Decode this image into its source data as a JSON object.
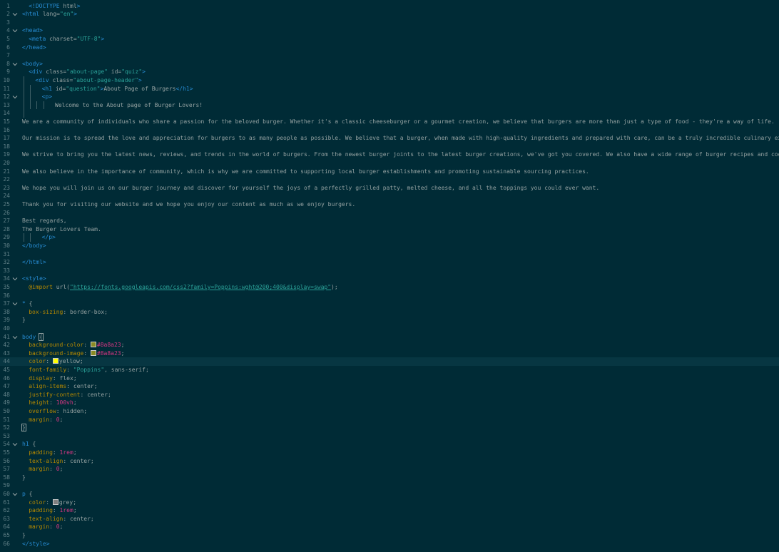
{
  "editor": {
    "active_line": 44,
    "colors": {
      "background": "#002b36",
      "active_line": "#073642",
      "tag": "#268bd2",
      "string": "#2aa198",
      "property": "#b58900",
      "number": "#d33682"
    },
    "lines": [
      {
        "n": "1",
        "indent": 1,
        "fold": false,
        "segments": [
          {
            "t": "doc",
            "s": "<!DOCTYPE"
          },
          {
            "t": "attr",
            "s": " html"
          },
          {
            "t": "doc",
            "s": ">"
          }
        ]
      },
      {
        "n": "2",
        "indent": 0,
        "fold": true,
        "segments": [
          {
            "t": "tag",
            "s": "<html"
          },
          {
            "t": "attr",
            "s": " lang="
          },
          {
            "t": "val",
            "s": "\"en\""
          },
          {
            "t": "tag",
            "s": ">"
          }
        ]
      },
      {
        "n": "3",
        "indent": 0,
        "fold": false,
        "segments": []
      },
      {
        "n": "4",
        "indent": 0,
        "fold": true,
        "segments": [
          {
            "t": "tag",
            "s": "<head>"
          }
        ]
      },
      {
        "n": "5",
        "indent": 1,
        "fold": false,
        "segments": [
          {
            "t": "tag",
            "s": "<meta"
          },
          {
            "t": "attr",
            "s": " charset="
          },
          {
            "t": "val",
            "s": "\"UTF-8\""
          },
          {
            "t": "tag",
            "s": ">"
          }
        ]
      },
      {
        "n": "6",
        "indent": 0,
        "fold": false,
        "segments": [
          {
            "t": "tag",
            "s": "</head>"
          }
        ]
      },
      {
        "n": "7",
        "indent": 0,
        "fold": false,
        "segments": []
      },
      {
        "n": "8",
        "indent": 0,
        "fold": true,
        "segments": [
          {
            "t": "tag",
            "s": "<body>"
          }
        ]
      },
      {
        "n": "9",
        "indent": 1,
        "fold": false,
        "segments": [
          {
            "t": "tag",
            "s": "<div"
          },
          {
            "t": "attr",
            "s": " class="
          },
          {
            "t": "val",
            "s": "\"about-page\""
          },
          {
            "t": "attr",
            "s": " id="
          },
          {
            "t": "val",
            "s": "\"quiz\""
          },
          {
            "t": "tag",
            "s": ">"
          }
        ]
      },
      {
        "n": "10",
        "indent": 2,
        "fold": false,
        "segments": [
          {
            "t": "tag",
            "s": "<div"
          },
          {
            "t": "attr",
            "s": " class="
          },
          {
            "t": "val",
            "s": "\"about-page-header\""
          },
          {
            "t": "tag",
            "s": ">"
          }
        ]
      },
      {
        "n": "11",
        "indent": 3,
        "fold": false,
        "segments": [
          {
            "t": "tag",
            "s": "<h1"
          },
          {
            "t": "attr",
            "s": " id="
          },
          {
            "t": "val",
            "s": "\"question\""
          },
          {
            "t": "tag",
            "s": ">"
          },
          {
            "t": "text",
            "s": "About Page of Burgers"
          },
          {
            "t": "tag",
            "s": "</h1>"
          }
        ]
      },
      {
        "n": "12",
        "indent": 3,
        "fold": true,
        "segments": [
          {
            "t": "tag",
            "s": "<p>"
          }
        ]
      },
      {
        "n": "13",
        "indent": 5,
        "fold": false,
        "segments": [
          {
            "t": "text",
            "s": "Welcome to the About page of Burger Lovers!"
          }
        ]
      },
      {
        "n": "14",
        "indent": 0,
        "fold": false,
        "guides": [
          1
        ],
        "segments": []
      },
      {
        "n": "15",
        "indent": 0,
        "fold": false,
        "segments": [
          {
            "t": "text",
            "s": "We are a community of individuals who share a passion for the beloved burger. Whether it's a classic cheeseburger or a gourmet creation, we believe that burgers are more than just a type of food - they're a way of life."
          }
        ]
      },
      {
        "n": "16",
        "indent": 0,
        "fold": false,
        "segments": []
      },
      {
        "n": "17",
        "indent": 0,
        "fold": false,
        "segments": [
          {
            "t": "text",
            "s": "Our mission is to spread the love and appreciation for burgers to as many people as possible. We believe that a burger, when made with high-quality ingredients and prepared with care, can be a truly incredible culinary experience."
          }
        ]
      },
      {
        "n": "18",
        "indent": 0,
        "fold": false,
        "segments": []
      },
      {
        "n": "19",
        "indent": 0,
        "fold": false,
        "segments": [
          {
            "t": "text",
            "s": "We strive to bring you the latest news, reviews, and trends in the world of burgers. From the newest burger joints to the latest burger creations, we've got you covered. We also have a wide range of burger recipes and cooking tips f"
          }
        ]
      },
      {
        "n": "20",
        "indent": 0,
        "fold": false,
        "segments": []
      },
      {
        "n": "21",
        "indent": 0,
        "fold": false,
        "segments": [
          {
            "t": "text",
            "s": "We also believe in the importance of community, which is why we are committed to supporting local burger establishments and promoting sustainable sourcing practices."
          }
        ]
      },
      {
        "n": "22",
        "indent": 0,
        "fold": false,
        "segments": []
      },
      {
        "n": "23",
        "indent": 0,
        "fold": false,
        "segments": [
          {
            "t": "text",
            "s": "We hope you will join us on our burger journey and discover for yourself the joys of a perfectly grilled patty, melted cheese, and all the toppings you could ever want."
          }
        ]
      },
      {
        "n": "24",
        "indent": 0,
        "fold": false,
        "segments": []
      },
      {
        "n": "25",
        "indent": 0,
        "fold": false,
        "segments": [
          {
            "t": "text",
            "s": "Thank you for visiting our website and we hope you enjoy our content as much as we enjoy burgers."
          }
        ]
      },
      {
        "n": "26",
        "indent": 0,
        "fold": false,
        "segments": []
      },
      {
        "n": "27",
        "indent": 0,
        "fold": false,
        "segments": [
          {
            "t": "text",
            "s": "Best regards,"
          }
        ]
      },
      {
        "n": "28",
        "indent": 0,
        "fold": false,
        "segments": [
          {
            "t": "text",
            "s": "The Burger Lovers Team."
          }
        ]
      },
      {
        "n": "29",
        "indent": 3,
        "fold": false,
        "guides": [
          1,
          2
        ],
        "segments": [
          {
            "t": "tag",
            "s": "</p>"
          }
        ]
      },
      {
        "n": "30",
        "indent": 0,
        "fold": false,
        "segments": [
          {
            "t": "tag",
            "s": "</body>"
          }
        ]
      },
      {
        "n": "31",
        "indent": 0,
        "fold": false,
        "segments": []
      },
      {
        "n": "32",
        "indent": 0,
        "fold": false,
        "segments": [
          {
            "t": "tag",
            "s": "</html>"
          }
        ]
      },
      {
        "n": "33",
        "indent": 0,
        "fold": false,
        "segments": []
      },
      {
        "n": "34",
        "indent": 0,
        "fold": true,
        "segments": [
          {
            "t": "tag",
            "s": "<style>"
          }
        ]
      },
      {
        "n": "35",
        "indent": 1,
        "fold": false,
        "segments": [
          {
            "t": "at",
            "s": "@import"
          },
          {
            "t": "fn",
            "s": " url("
          },
          {
            "t": "url",
            "s": "\"https://fonts.googleapis.com/css2?family=Poppins:wght@200;400&display=swap\""
          },
          {
            "t": "fn",
            "s": ");"
          }
        ]
      },
      {
        "n": "36",
        "indent": 0,
        "fold": false,
        "segments": []
      },
      {
        "n": "37",
        "indent": 0,
        "fold": true,
        "segments": [
          {
            "t": "sel",
            "s": "*"
          },
          {
            "t": "punc",
            "s": " {"
          }
        ]
      },
      {
        "n": "38",
        "indent": 1,
        "fold": false,
        "segments": [
          {
            "t": "prop",
            "s": "box-sizing"
          },
          {
            "t": "punc",
            "s": ": "
          },
          {
            "t": "text",
            "s": "border-box;"
          }
        ]
      },
      {
        "n": "39",
        "indent": 0,
        "fold": false,
        "segments": [
          {
            "t": "punc",
            "s": "}"
          }
        ]
      },
      {
        "n": "40",
        "indent": 0,
        "fold": false,
        "segments": []
      },
      {
        "n": "41",
        "indent": 0,
        "fold": true,
        "segments": [
          {
            "t": "sel",
            "s": "body"
          },
          {
            "t": "punc",
            "s": " "
          },
          {
            "t": "brace",
            "s": "{"
          }
        ]
      },
      {
        "n": "42",
        "indent": 1,
        "fold": false,
        "segments": [
          {
            "t": "prop",
            "s": "background-color"
          },
          {
            "t": "punc",
            "s": ": "
          },
          {
            "t": "swatch",
            "s": "#8a8a23"
          },
          {
            "t": "num",
            "s": "#8a8a23"
          },
          {
            "t": "punc",
            "s": ";"
          }
        ]
      },
      {
        "n": "43",
        "indent": 1,
        "fold": false,
        "segments": [
          {
            "t": "prop",
            "s": "background-image"
          },
          {
            "t": "punc",
            "s": ": "
          },
          {
            "t": "swatch",
            "s": "#8a8a23"
          },
          {
            "t": "num",
            "s": "#8a8a23"
          },
          {
            "t": "punc",
            "s": ";"
          }
        ]
      },
      {
        "n": "44",
        "indent": 1,
        "fold": false,
        "segments": [
          {
            "t": "prop",
            "s": "color"
          },
          {
            "t": "punc",
            "s": ": "
          },
          {
            "t": "swatch",
            "s": "#ffff00"
          },
          {
            "t": "text",
            "s": "yellow;"
          }
        ]
      },
      {
        "n": "45",
        "indent": 1,
        "fold": false,
        "segments": [
          {
            "t": "prop",
            "s": "font-family"
          },
          {
            "t": "punc",
            "s": ": "
          },
          {
            "t": "val",
            "s": "\"Poppins\""
          },
          {
            "t": "text",
            "s": ", sans-serif;"
          }
        ]
      },
      {
        "n": "46",
        "indent": 1,
        "fold": false,
        "segments": [
          {
            "t": "prop",
            "s": "display"
          },
          {
            "t": "punc",
            "s": ": "
          },
          {
            "t": "text",
            "s": "flex;"
          }
        ]
      },
      {
        "n": "47",
        "indent": 1,
        "fold": false,
        "segments": [
          {
            "t": "prop",
            "s": "align-items"
          },
          {
            "t": "punc",
            "s": ": "
          },
          {
            "t": "text",
            "s": "center;"
          }
        ]
      },
      {
        "n": "48",
        "indent": 1,
        "fold": false,
        "segments": [
          {
            "t": "prop",
            "s": "justify-content"
          },
          {
            "t": "punc",
            "s": ": "
          },
          {
            "t": "text",
            "s": "center;"
          }
        ]
      },
      {
        "n": "49",
        "indent": 1,
        "fold": false,
        "segments": [
          {
            "t": "prop",
            "s": "height"
          },
          {
            "t": "punc",
            "s": ": "
          },
          {
            "t": "num",
            "s": "100vh"
          },
          {
            "t": "punc",
            "s": ";"
          }
        ]
      },
      {
        "n": "50",
        "indent": 1,
        "fold": false,
        "segments": [
          {
            "t": "prop",
            "s": "overflow"
          },
          {
            "t": "punc",
            "s": ": "
          },
          {
            "t": "text",
            "s": "hidden;"
          }
        ]
      },
      {
        "n": "51",
        "indent": 1,
        "fold": false,
        "segments": [
          {
            "t": "prop",
            "s": "margin"
          },
          {
            "t": "punc",
            "s": ": "
          },
          {
            "t": "num",
            "s": "0"
          },
          {
            "t": "punc",
            "s": ";"
          }
        ]
      },
      {
        "n": "52",
        "indent": 0,
        "fold": false,
        "segments": [
          {
            "t": "brace",
            "s": "}"
          }
        ]
      },
      {
        "n": "53",
        "indent": 0,
        "fold": false,
        "segments": []
      },
      {
        "n": "54",
        "indent": 0,
        "fold": true,
        "segments": [
          {
            "t": "sel",
            "s": "h1"
          },
          {
            "t": "punc",
            "s": " {"
          }
        ]
      },
      {
        "n": "55",
        "indent": 1,
        "fold": false,
        "segments": [
          {
            "t": "prop",
            "s": "padding"
          },
          {
            "t": "punc",
            "s": ": "
          },
          {
            "t": "num",
            "s": "1rem"
          },
          {
            "t": "punc",
            "s": ";"
          }
        ]
      },
      {
        "n": "56",
        "indent": 1,
        "fold": false,
        "segments": [
          {
            "t": "prop",
            "s": "text-align"
          },
          {
            "t": "punc",
            "s": ": "
          },
          {
            "t": "text",
            "s": "center;"
          }
        ]
      },
      {
        "n": "57",
        "indent": 1,
        "fold": false,
        "segments": [
          {
            "t": "prop",
            "s": "margin"
          },
          {
            "t": "punc",
            "s": ": "
          },
          {
            "t": "num",
            "s": "0"
          },
          {
            "t": "punc",
            "s": ";"
          }
        ]
      },
      {
        "n": "58",
        "indent": 0,
        "fold": false,
        "segments": [
          {
            "t": "punc",
            "s": "}"
          }
        ]
      },
      {
        "n": "59",
        "indent": 0,
        "fold": false,
        "segments": []
      },
      {
        "n": "60",
        "indent": 0,
        "fold": true,
        "segments": [
          {
            "t": "sel",
            "s": "p"
          },
          {
            "t": "punc",
            "s": " {"
          }
        ]
      },
      {
        "n": "61",
        "indent": 1,
        "fold": false,
        "segments": [
          {
            "t": "prop",
            "s": "color"
          },
          {
            "t": "punc",
            "s": ": "
          },
          {
            "t": "swatch",
            "s": "#808080"
          },
          {
            "t": "text",
            "s": "grey;"
          }
        ]
      },
      {
        "n": "62",
        "indent": 1,
        "fold": false,
        "segments": [
          {
            "t": "prop",
            "s": "padding"
          },
          {
            "t": "punc",
            "s": ": "
          },
          {
            "t": "num",
            "s": "1rem"
          },
          {
            "t": "punc",
            "s": ";"
          }
        ]
      },
      {
        "n": "63",
        "indent": 1,
        "fold": false,
        "segments": [
          {
            "t": "prop",
            "s": "text-align"
          },
          {
            "t": "punc",
            "s": ": "
          },
          {
            "t": "text",
            "s": "center;"
          }
        ]
      },
      {
        "n": "64",
        "indent": 1,
        "fold": false,
        "segments": [
          {
            "t": "prop",
            "s": "margin"
          },
          {
            "t": "punc",
            "s": ": "
          },
          {
            "t": "num",
            "s": "0"
          },
          {
            "t": "punc",
            "s": ";"
          }
        ]
      },
      {
        "n": "65",
        "indent": 0,
        "fold": false,
        "segments": [
          {
            "t": "punc",
            "s": "}"
          }
        ]
      },
      {
        "n": "66",
        "indent": 0,
        "fold": false,
        "segments": [
          {
            "t": "tag",
            "s": "</style>"
          }
        ]
      }
    ]
  }
}
